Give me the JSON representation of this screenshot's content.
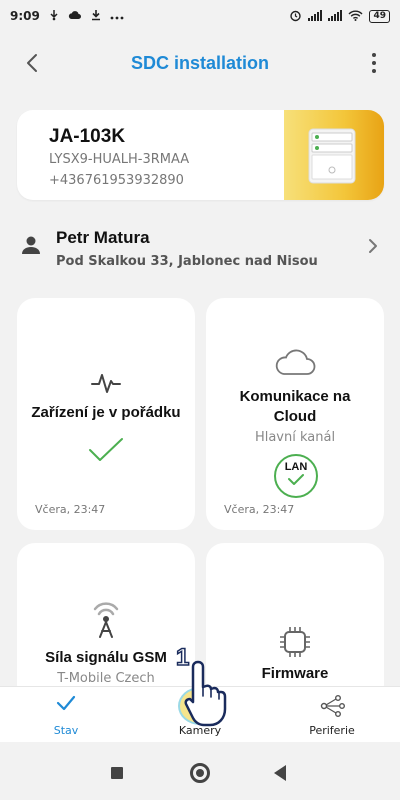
{
  "status_bar": {
    "time": "9:09",
    "battery": "49",
    "icons_left": [
      "usb-debug-icon",
      "cloud-icon",
      "download-icon",
      "more-dots-icon"
    ],
    "icons_right": [
      "alarm-icon",
      "signal-icon",
      "signal-icon",
      "wifi-icon",
      "battery-icon"
    ]
  },
  "app_bar": {
    "title": "SDC installation",
    "back_icon": "chevron-left-icon",
    "menu_icon": "more-vertical-icon"
  },
  "device": {
    "name": "JA-103K",
    "serial": "LYSX9-HUALH-3RMAA",
    "phone": "+436761953932890",
    "accent_colors": [
      "#f7e07a",
      "#f3c63a",
      "#e8a315"
    ]
  },
  "user": {
    "name": "Petr Matura",
    "address": "Pod Skalkou 33, Jablonec nad Nisou"
  },
  "tiles": {
    "status": {
      "title": "Zařízení je v pořádku",
      "time": "Včera, 23:47",
      "icon": "pulse-icon",
      "ok_icon": "check-icon"
    },
    "cloud": {
      "title_line1": "Komunikace na",
      "title_line2": "Cloud",
      "subtitle": "Hlavní kanál",
      "badge": "LAN",
      "time": "Včera, 23:47",
      "icon": "cloud-icon"
    },
    "signal": {
      "title": "Síla signálu GSM",
      "subtitle": "T-Mobile Czech",
      "icon": "antenna-icon"
    },
    "firmware": {
      "title": "Firmware",
      "icon": "chip-icon"
    }
  },
  "bottom_nav": {
    "items": [
      {
        "label": "Stav",
        "icon": "check-icon",
        "active": true
      },
      {
        "label": "Kamery",
        "icon": "camera-icon",
        "active": false
      },
      {
        "label": "Periferie",
        "icon": "share-nodes-icon",
        "active": false
      }
    ]
  },
  "tutorial_marker": {
    "step": "1"
  },
  "colors": {
    "accent_blue": "#1f8ad6",
    "ok_green": "#4caf50",
    "highlight_yellow": "#f6e58d"
  }
}
